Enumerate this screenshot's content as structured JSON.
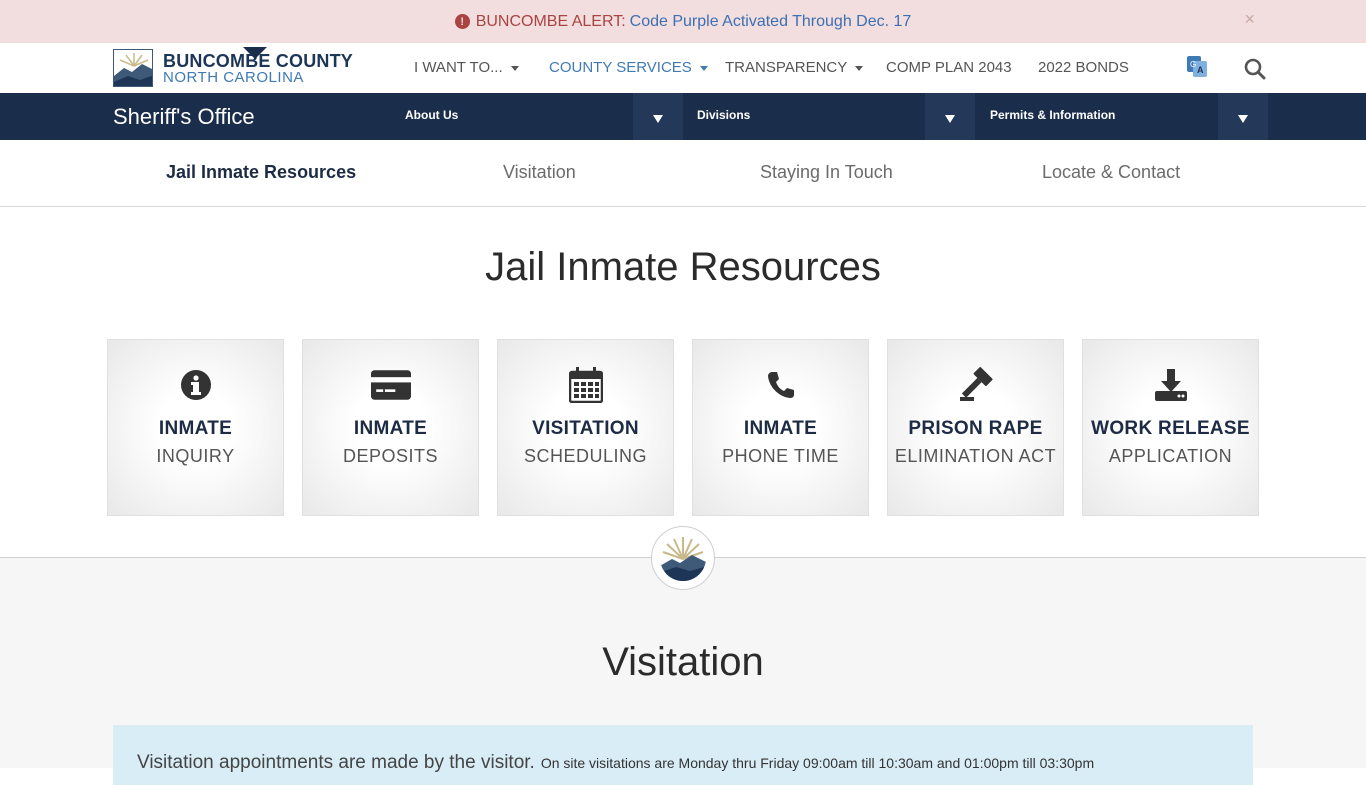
{
  "alert": {
    "label": "BUNCOMBE ALERT:",
    "link_text": "Code Purple Activated Through Dec. 17",
    "close_glyph": "×"
  },
  "logo": {
    "line1": "BUNCOMBE COUNTY",
    "line2": "NORTH CAROLINA"
  },
  "topnav": {
    "items": [
      {
        "label": "I WANT TO...",
        "dropdown": true
      },
      {
        "label": "COUNTY SERVICES",
        "dropdown": true,
        "active": true
      },
      {
        "label": "TRANSPARENCY",
        "dropdown": true
      },
      {
        "label": "COMP PLAN 2043",
        "dropdown": false
      },
      {
        "label": "2022 BONDS",
        "dropdown": false
      }
    ],
    "translate_icon": "translate-icon",
    "search_icon": "search-icon"
  },
  "section": {
    "title": "Sheriff's Office",
    "menus": [
      {
        "label": "About Us"
      },
      {
        "label": "Divisions"
      },
      {
        "label": "Permits & Information"
      }
    ]
  },
  "subnav": {
    "items": [
      {
        "label": "Jail Inmate Resources",
        "active": true
      },
      {
        "label": "Visitation"
      },
      {
        "label": "Staying In Touch"
      },
      {
        "label": "Locate & Contact"
      }
    ]
  },
  "main": {
    "title": "Jail Inmate Resources",
    "tiles": [
      {
        "line1": "INMATE",
        "line2": "INQUIRY",
        "icon": "info-circle-icon"
      },
      {
        "line1": "INMATE",
        "line2": "DEPOSITS",
        "icon": "credit-card-icon"
      },
      {
        "line1": "VISITATION",
        "line2": "SCHEDULING",
        "icon": "calendar-icon"
      },
      {
        "line1": "INMATE",
        "line2": "PHONE TIME",
        "icon": "phone-icon"
      },
      {
        "line1": "PRISON RAPE",
        "line2": "ELIMINATION ACT",
        "icon": "gavel-icon"
      },
      {
        "line1": "WORK RELEASE",
        "line2": "APPLICATION",
        "icon": "download-icon"
      }
    ]
  },
  "visitation": {
    "title": "Visitation",
    "info_big": "Visitation appointments are made by the visitor.",
    "info_small": "On site visitations are Monday thru Friday 09:00am till 10:30am and 01:00pm till 03:30pm"
  },
  "colors": {
    "navy": "#1a2d4a",
    "accent_blue": "#3f7ab5",
    "alert_bg": "#f2dede",
    "alert_red": "#a94442",
    "info_bg": "#d9edf7"
  }
}
